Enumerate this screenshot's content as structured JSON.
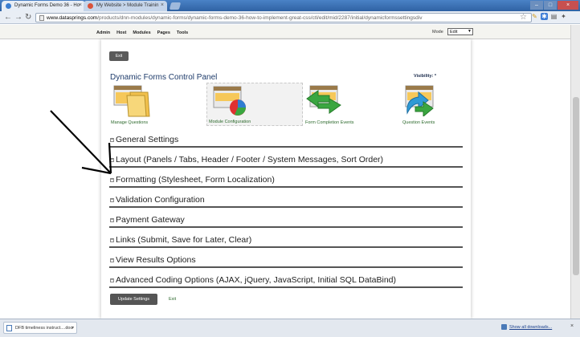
{
  "browser": {
    "tabs": [
      {
        "title": "Dynamic Forms Demo 36 - Ho",
        "active": true
      },
      {
        "title": "My Website > Module Trainin",
        "active": false
      }
    ],
    "url_domain": "www.datasprings.com",
    "url_path": "/products/dnn-modules/dynamic-forms/dynamic-forms-demo-36-how-to-implement-great-css/ctl/edit/mid/2287/initial/dynamicformssettingsdiv"
  },
  "controlbar": {
    "menu": [
      "Admin",
      "Host",
      "Modules",
      "Pages",
      "Tools"
    ],
    "mode_label": "Mode",
    "mode_value": "Edit"
  },
  "panel": {
    "exit_top": "Exit",
    "title": "Dynamic Forms Control Panel",
    "visibility": "Visibility: *",
    "items": [
      {
        "label": "Manage Questions",
        "icon": "folder-icon"
      },
      {
        "label": "Module Configuration",
        "icon": "config-chart-icon"
      },
      {
        "label": "Form Completion Events",
        "icon": "completion-events-icon"
      },
      {
        "label": "Question Events",
        "icon": "question-events-icon"
      }
    ],
    "sections": [
      "General Settings",
      "Layout (Panels / Tabs, Header / Footer / System Messages, Sort Order)",
      "Formatting (Stylesheet, Form Localization)",
      "Validation Configuration",
      "Payment Gateway",
      "Links (Submit, Save for Later, Clear)",
      "View Results Options",
      "Advanced Coding Options (AJAX, jQuery, JavaScript, Initial SQL DataBind)"
    ],
    "update_button": "Update Settings",
    "exit_link": "Exit"
  },
  "downloads": {
    "item": "DFB timeliness instruct....doc",
    "show_all": "Show all downloads..."
  },
  "colors": {
    "section_text": "#1e1e1e",
    "link_green": "#2d6a2d",
    "title_blue": "#1f3c6b",
    "annotation_arrow": "#000000"
  }
}
